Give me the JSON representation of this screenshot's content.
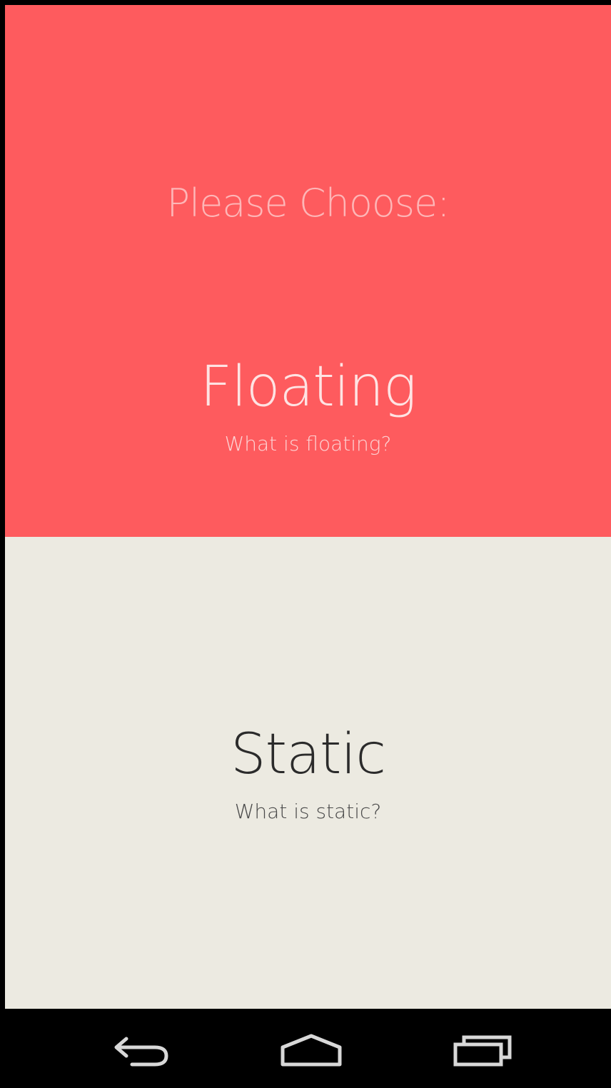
{
  "prompt": "Please Choose:",
  "options": [
    {
      "title": "Floating",
      "subtitle": "What is floating?"
    },
    {
      "title": "Static",
      "subtitle": "What is static?"
    }
  ],
  "colors": {
    "floating_panel": "#fe5b5e",
    "static_panel": "#eceae1",
    "navbar": "#000000"
  },
  "navbar": {
    "icons": [
      "back-icon",
      "home-icon",
      "recents-icon"
    ]
  }
}
